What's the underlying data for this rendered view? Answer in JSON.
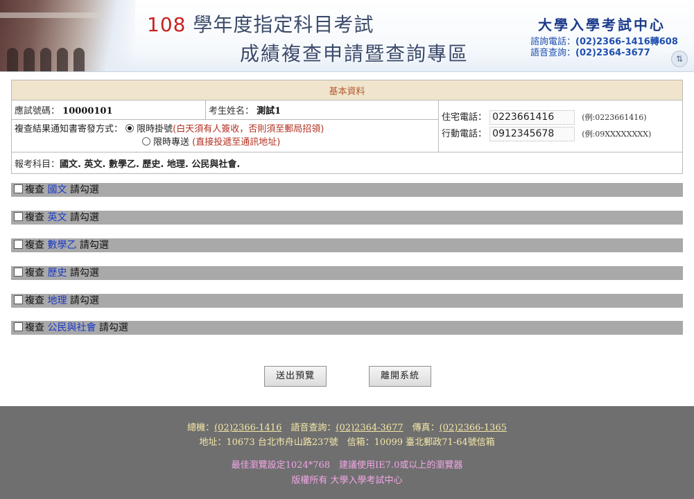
{
  "header": {
    "title_year": "108",
    "title_line1": " 學年度指定科目考試",
    "title_line2": "成績複查申請暨查詢專區",
    "org_name": "大學入學考試中心",
    "phone_label": "諮詢電話：",
    "phone_value": "(02)2366-1416轉608",
    "voice_label": "語音查詢：",
    "voice_value": "(02)2364-3677"
  },
  "info": {
    "section_title": "基本資料",
    "exam_no_label": "應試號碼：",
    "exam_no": "10000101",
    "name_label": "考生姓名：",
    "name": "測試1",
    "notify_label": "複查結果通知書寄發方式：",
    "option1_label": "限時掛號",
    "option1_note": "(白天須有人簽收，否則須至郵局招領)",
    "option2_label": "限時專送",
    "option2_note": "(直接投遞至通訊地址)",
    "home_phone_label": "住宅電話：",
    "home_phone": "0223661416",
    "home_phone_example": "(例:0223661416)",
    "mobile_label": "行動電話：",
    "mobile": "0912345678",
    "mobile_example": "(例:09XXXXXXXX)",
    "subjects_label": "報考科目：",
    "subjects": "國文. 英文. 數學乙. 歷史. 地理. 公民與社會."
  },
  "review": {
    "prefix": "複查",
    "suffix": "請勾選",
    "subjects": [
      "國文",
      "英文",
      "數學乙",
      "歷史",
      "地理",
      "公民與社會"
    ]
  },
  "buttons": {
    "submit": "送出預覽",
    "exit": "離開系統"
  },
  "footer": {
    "main_label": "總機：",
    "main_phone": "(02)2366-1416",
    "voice_label": "語音查詢：",
    "voice_phone": "(02)2364-3677",
    "fax_label": "傳真：",
    "fax": "(02)2366-1365",
    "address": "地址：10673 台北市舟山路237號　信箱：10099 臺北郵政71-64號信箱",
    "browser_note": "最佳瀏覽設定1024*768　建議使用IE7.0或以上的瀏覽器",
    "copyright": "版權所有 大學入學考試中心"
  }
}
